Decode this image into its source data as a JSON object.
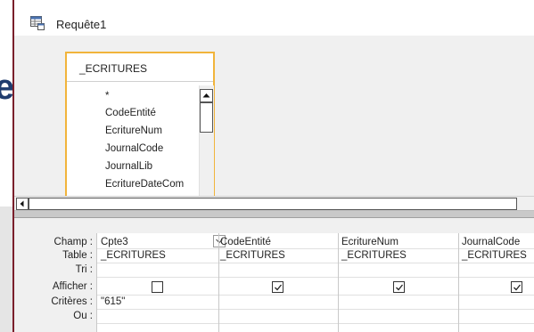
{
  "window": {
    "title": "Requête1"
  },
  "table_box": {
    "name": "_ECRITURES",
    "fields": [
      "*",
      "CodeEntité",
      "EcritureNum",
      "JournalCode",
      "JournalLib",
      "EcritureDateCom"
    ]
  },
  "grid": {
    "row_labels": [
      "Champ :",
      "Table :",
      "Tri :",
      "Afficher :",
      "Critères :",
      "Ou :"
    ],
    "columns": [
      {
        "field": "Cpte3",
        "table": "_ECRITURES",
        "show": false,
        "criteria": "\"615\""
      },
      {
        "field": "CodeEntité",
        "table": "_ECRITURES",
        "show": true,
        "criteria": ""
      },
      {
        "field": "EcritureNum",
        "table": "_ECRITURES",
        "show": true,
        "criteria": ""
      },
      {
        "field": "JournalCode",
        "table": "_ECRITURES",
        "show": true,
        "criteria": ""
      }
    ]
  },
  "background_slide": {
    "letter": "e"
  },
  "colors": {
    "table_border": "#f1b43b",
    "slide_text": "#1f3c6e"
  },
  "icons": {
    "title": "query-design-icon",
    "dropdown": "chevron-down-icon"
  }
}
